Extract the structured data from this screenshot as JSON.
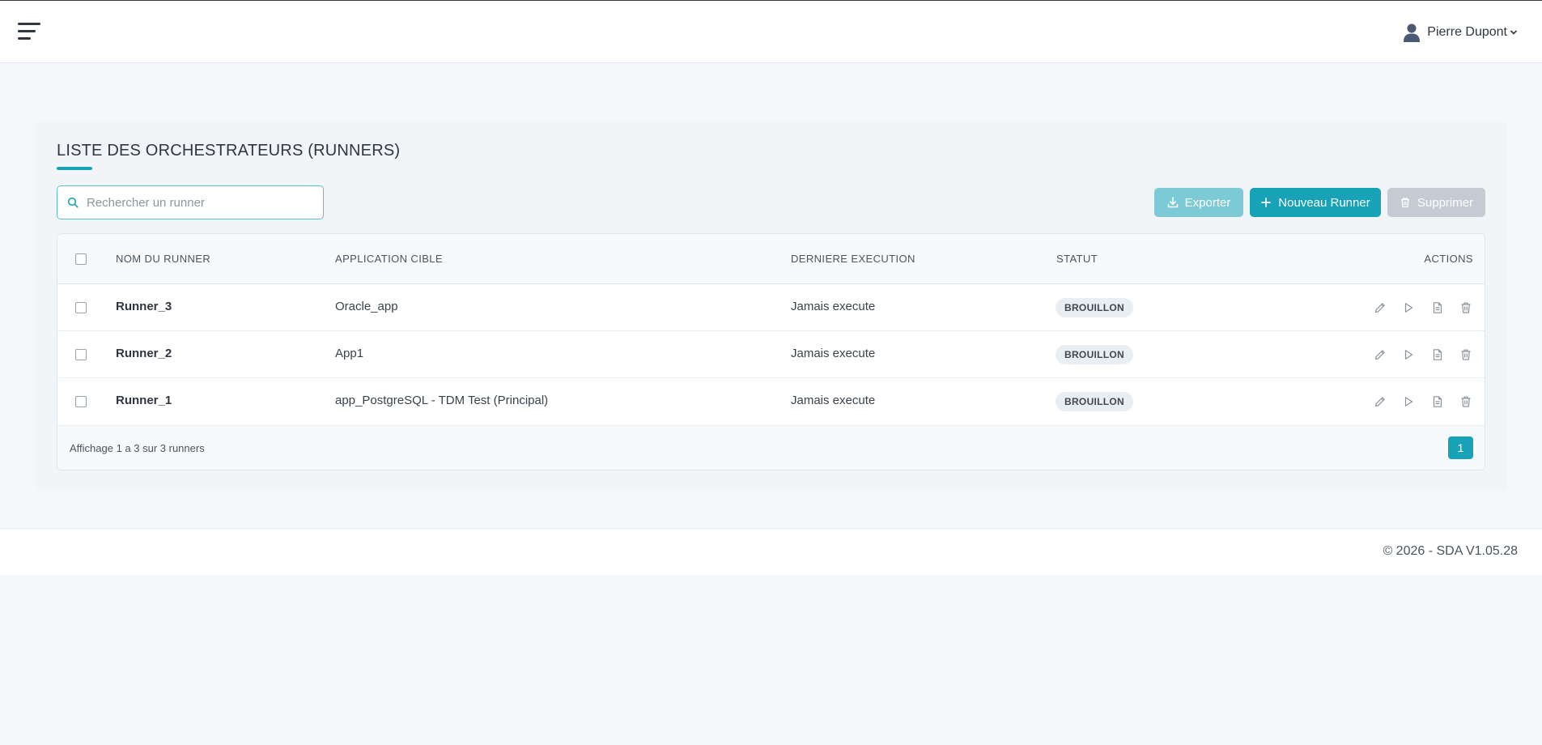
{
  "header": {
    "user_name": "Pierre Dupont"
  },
  "page": {
    "title": "LISTE DES ORCHESTRATEURS (RUNNERS)"
  },
  "search": {
    "placeholder": "Rechercher un runner",
    "value": ""
  },
  "toolbar": {
    "export_label": "Exporter",
    "new_label": "Nouveau Runner",
    "delete_label": "Supprimer"
  },
  "table": {
    "columns": {
      "name": "NOM DU RUNNER",
      "app": "APPLICATION CIBLE",
      "last_run": "DERNIERE EXECUTION",
      "status": "STATUT",
      "actions": "ACTIONS"
    },
    "rows": [
      {
        "name": "Runner_3",
        "app": "Oracle_app",
        "last_run": "Jamais execute",
        "status": "BROUILLON"
      },
      {
        "name": "Runner_2",
        "app": "App1",
        "last_run": "Jamais execute",
        "status": "BROUILLON"
      },
      {
        "name": "Runner_1",
        "app": "app_PostgreSQL - TDM Test (Principal)",
        "last_run": "Jamais execute",
        "status": "BROUILLON"
      }
    ],
    "footer_info": "Affichage 1 a 3 sur 3 runners",
    "current_page": "1"
  },
  "footer": {
    "copyright": "© 2026 - SDA V1.05.28"
  },
  "icons": {
    "menu": "hamburger-icon",
    "user": "user-icon",
    "dropdown": "chevron-down-icon",
    "search": "search-icon",
    "export": "download-icon",
    "new": "plus-icon",
    "delete": "trash-icon",
    "row_actions": [
      "edit-icon",
      "play-icon",
      "file-icon",
      "trash-icon"
    ]
  },
  "colors": {
    "accent": "#17a2b8",
    "accent_light": "#7ccad6",
    "disabled": "#c4cbd2",
    "background": "#f5f8fa"
  }
}
